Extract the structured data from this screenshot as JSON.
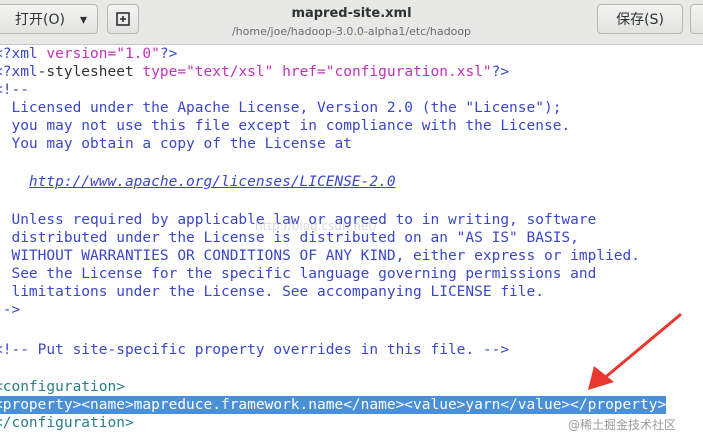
{
  "header": {
    "open_label": "打开(O)",
    "open_chevron": "▾",
    "new_tab_glyph": "⊞",
    "title": "mapred-site.xml",
    "path": "/home/joe/hadoop-3.0.0-alpha1/etc/hadoop",
    "save_label": "保存(S)"
  },
  "editor": {
    "line1": {
      "a": "<?xml ",
      "b": "version=",
      "c": "\"1.0\"",
      "d": "?>"
    },
    "line2": {
      "a": "<?xml",
      "b": "-stylesheet ",
      "c": "type=",
      "d": "\"text/xsl\"",
      "e": " href=",
      "f": "\"configuration.xsl\"",
      "g": "?>"
    },
    "line3": "<!--",
    "line4": "  Licensed under the Apache License, Version 2.0 (the \"License\");",
    "line5": "  you may not use this file except in compliance with the License.",
    "line6": "  You may obtain a copy of the License at",
    "line7": "    ",
    "line7_link": "http://www.apache.org/licenses/LICENSE-2.0",
    "line8": "  Unless required by applicable law or agreed to in writing, software",
    "line9": "  distributed under the License is distributed on an \"AS IS\" BASIS,",
    "line10": "  WITHOUT WARRANTIES OR CONDITIONS OF ANY KIND, either express or implied.",
    "line11": "  See the License for the specific language governing permissions and",
    "line12": "  limitations under the License. See accompanying LICENSE file.",
    "line13": "-->",
    "line14": "<!-- Put site-specific property overrides in this file. -->",
    "line15": "<configuration>",
    "line16": "<property><name>mapreduce.framework.name</name><value>yarn</value></property>",
    "line17": "</configuration>"
  },
  "overlay": {
    "watermark": "http://blog.csdn.net/",
    "badge": "@稀土掘金技术社区"
  },
  "colors": {
    "tag": "#3b47c7",
    "attr": "#c132b8",
    "comment": "#2a7f86",
    "selection": "#4a90d9",
    "arrow": "#e8392f"
  }
}
